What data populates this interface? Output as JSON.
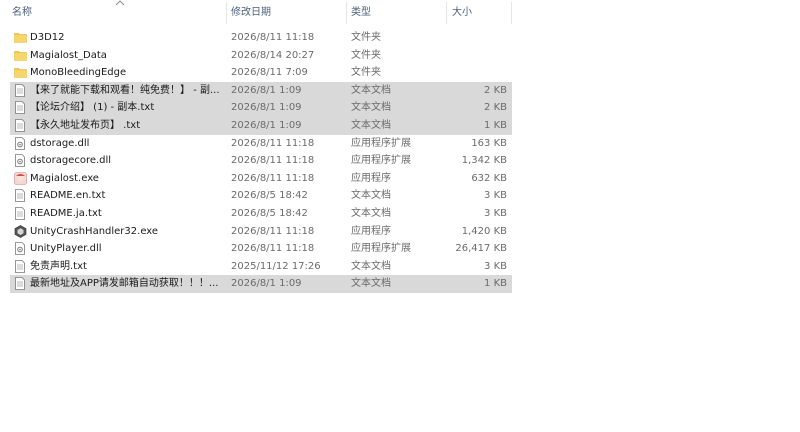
{
  "header": {
    "name": "名称",
    "date": "修改日期",
    "type": "类型",
    "size": "大小",
    "sort_icon": "chevron-up-icon"
  },
  "files": [
    {
      "name": "D3D12",
      "date": "2026/8/11 11:18",
      "type": "文件夹",
      "size": "",
      "icon": "folder-icon",
      "selected": false
    },
    {
      "name": "Magialost_Data",
      "date": "2026/8/14 20:27",
      "type": "文件夹",
      "size": "",
      "icon": "folder-icon",
      "selected": false
    },
    {
      "name": "MonoBleedingEdge",
      "date": "2026/8/11 7:09",
      "type": "文件夹",
      "size": "",
      "icon": "folder-icon",
      "selected": false
    },
    {
      "name": "【来了就能下载和观看！纯免费！】 - 副...",
      "date": "2026/8/1 1:09",
      "type": "文本文档",
      "size": "2 KB",
      "icon": "text-file-icon",
      "selected": true
    },
    {
      "name": "【论坛介绍】 (1) - 副本.txt",
      "date": "2026/8/1 1:09",
      "type": "文本文档",
      "size": "2 KB",
      "icon": "text-file-icon",
      "selected": true
    },
    {
      "name": "【永久地址发布页】 .txt",
      "date": "2026/8/1 1:09",
      "type": "文本文档",
      "size": "1 KB",
      "icon": "text-file-icon",
      "selected": true
    },
    {
      "name": "dstorage.dll",
      "date": "2026/8/11 11:18",
      "type": "应用程序扩展",
      "size": "163 KB",
      "icon": "dll-file-icon",
      "selected": false
    },
    {
      "name": "dstoragecore.dll",
      "date": "2026/8/11 11:18",
      "type": "应用程序扩展",
      "size": "1,342 KB",
      "icon": "dll-file-icon",
      "selected": false
    },
    {
      "name": "Magialost.exe",
      "date": "2026/8/11 11:18",
      "type": "应用程序",
      "size": "632 KB",
      "icon": "app-exe-icon",
      "selected": false
    },
    {
      "name": "README.en.txt",
      "date": "2026/8/5 18:42",
      "type": "文本文档",
      "size": "3 KB",
      "icon": "text-file-icon",
      "selected": false
    },
    {
      "name": "README.ja.txt",
      "date": "2026/8/5 18:42",
      "type": "文本文档",
      "size": "3 KB",
      "icon": "text-file-icon",
      "selected": false
    },
    {
      "name": "UnityCrashHandler32.exe",
      "date": "2026/8/11 11:18",
      "type": "应用程序",
      "size": "1,420 KB",
      "icon": "unity-exe-icon",
      "selected": false
    },
    {
      "name": "UnityPlayer.dll",
      "date": "2026/8/11 11:18",
      "type": "应用程序扩展",
      "size": "26,417 KB",
      "icon": "dll-file-icon",
      "selected": false
    },
    {
      "name": "免责声明.txt",
      "date": "2025/11/12 17:26",
      "type": "文本文档",
      "size": "3 KB",
      "icon": "text-file-icon",
      "selected": false
    },
    {
      "name": "最新地址及APP请发邮箱自动获取！！！...",
      "date": "2026/8/1 1:09",
      "type": "文本文档",
      "size": "1 KB",
      "icon": "text-file-icon",
      "selected": true
    }
  ],
  "colors": {
    "folder": "#f2c94c",
    "selected_bg": "#d9d9d9",
    "header_text": "#4c607a"
  }
}
